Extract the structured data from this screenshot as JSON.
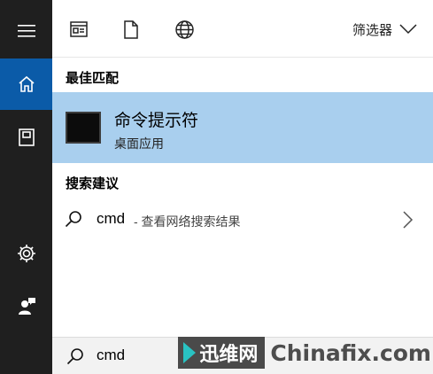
{
  "rail": {
    "items": [
      {
        "icon": "hamburger-icon",
        "active": false
      },
      {
        "icon": "home-icon",
        "active": true
      },
      {
        "icon": "notebook-icon",
        "active": false
      },
      {
        "icon": "gear-icon",
        "active": false
      },
      {
        "icon": "feedback-person-icon",
        "active": false
      }
    ]
  },
  "topbar": {
    "icons": [
      "apps-icon",
      "document-icon",
      "web-globe-icon"
    ],
    "filter_label": "筛选器"
  },
  "best_match": {
    "heading": "最佳匹配",
    "title": "命令提示符",
    "subtitle": "桌面应用"
  },
  "suggestions": {
    "heading": "搜索建议",
    "items": [
      {
        "term": "cmd",
        "hint": "- 查看网络搜索结果"
      }
    ]
  },
  "search": {
    "query": "cmd"
  },
  "watermark": {
    "brand_cn": "迅维网",
    "site": "Chinafix.com"
  },
  "colors": {
    "rail_bg": "#1f1f1f",
    "rail_active": "#0b5ba8",
    "highlight": "#a9cfee"
  }
}
